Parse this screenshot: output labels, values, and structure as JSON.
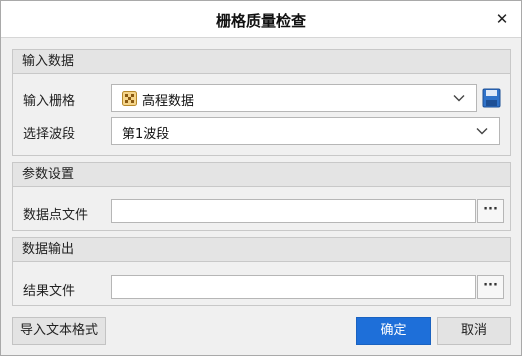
{
  "dialog": {
    "title": "栅格质量检查",
    "close_glyph": "✕"
  },
  "input_group": {
    "header": "输入数据",
    "raster_label": "输入栅格",
    "raster_value": "高程数据",
    "band_label": "选择波段",
    "band_value": "第1波段"
  },
  "params_group": {
    "header": "参数设置",
    "points_label": "数据点文件",
    "points_value": "",
    "browse_label": "···"
  },
  "output_group": {
    "header": "数据输出",
    "result_label": "结果文件",
    "result_value": "",
    "browse_label": "···"
  },
  "footer": {
    "import_label": "导入文本格式",
    "ok_label": "确定",
    "cancel_label": "取消"
  },
  "colors": {
    "primary": "#1e6fd9",
    "header_bg": "#e4e4e4"
  }
}
